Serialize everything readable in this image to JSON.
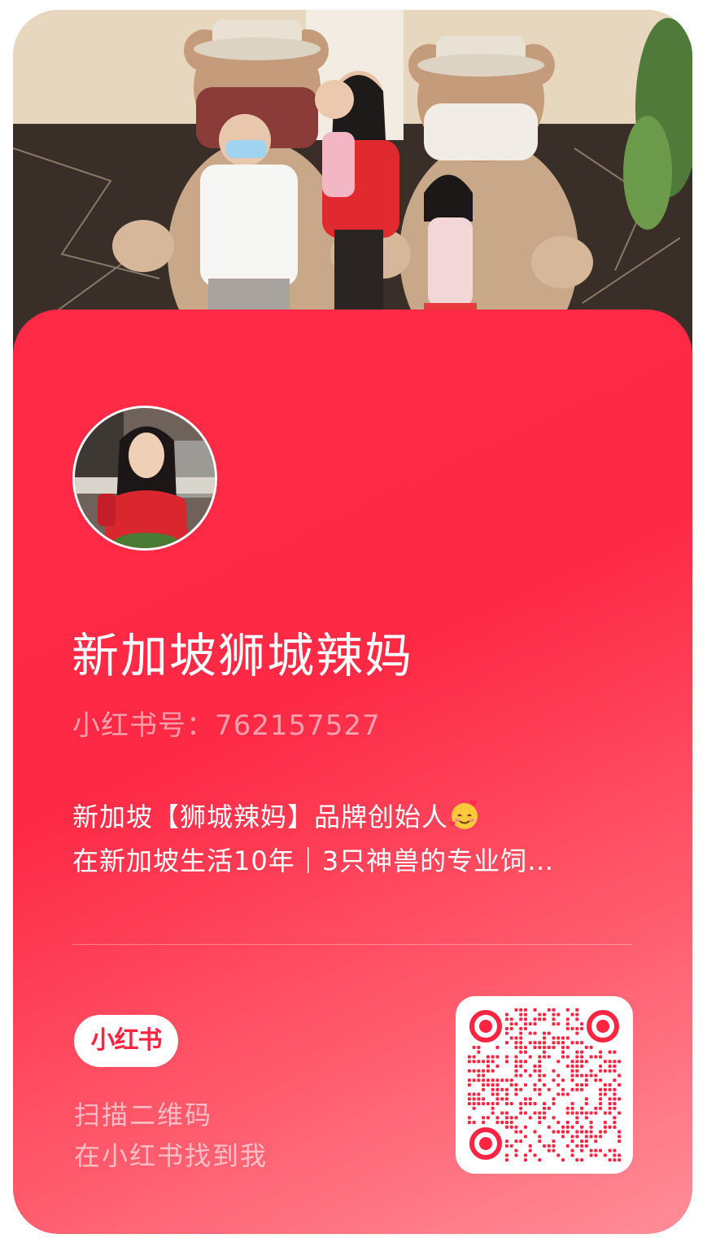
{
  "profile": {
    "name": "新加坡狮城辣妈",
    "redbook_id_label": "小红书号：",
    "redbook_id": "762157527",
    "bio_line1": "新加坡【狮城辣妈】品牌创始人",
    "bio_line2": "在新加坡生活10年｜3只神兽的专业饲…",
    "bio_emoji": "smiling-face-with-hearts-icon"
  },
  "brand": {
    "logo_text": "小红书",
    "accent": "#ff2442"
  },
  "scan": {
    "line1": "扫描二维码",
    "line2": "在小红书找到我"
  },
  "images": {
    "cover": "photo of family with bear mascots",
    "avatar": "profile photo"
  }
}
